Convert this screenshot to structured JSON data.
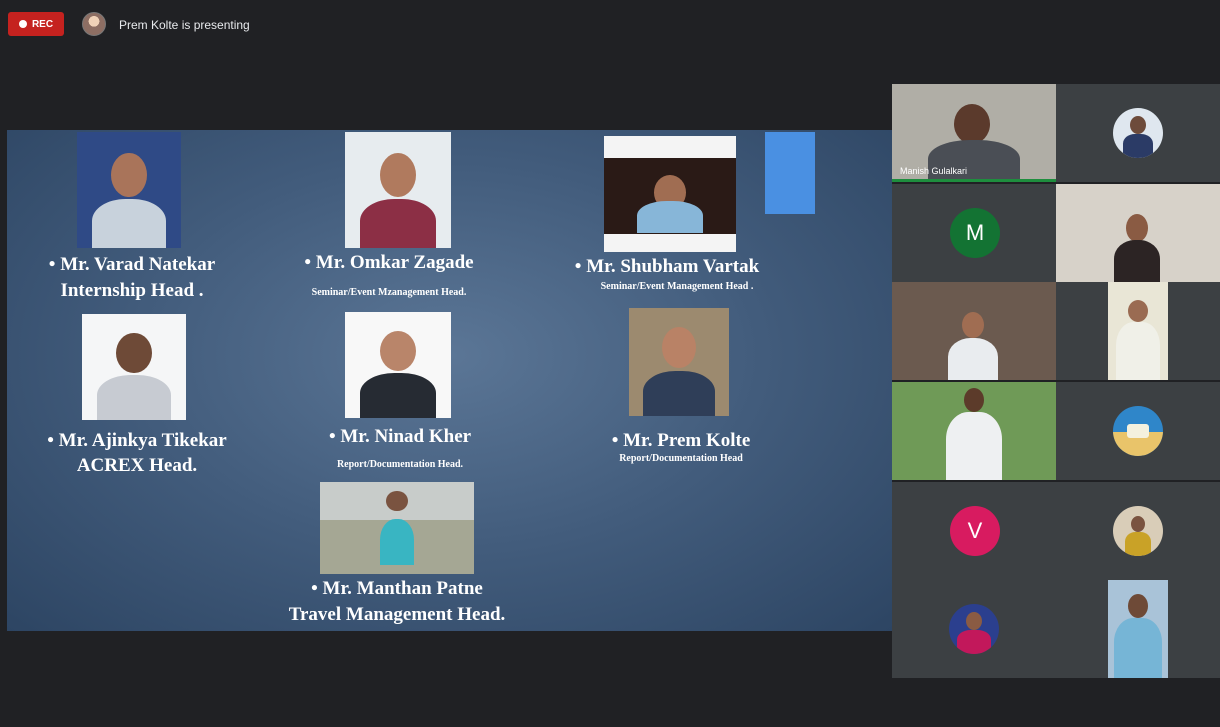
{
  "meeting": {
    "rec_label": "REC",
    "presenting_text": "Prem Kolte is presenting"
  },
  "slide": {
    "members": [
      {
        "name": "• Mr. Varad Natekar",
        "role": "Internship Head ."
      },
      {
        "name": "• Mr. Omkar Zagade",
        "role": "Seminar/Event Mzanagement Head."
      },
      {
        "name": "• Mr. Shubham Vartak",
        "role": "Seminar/Event Management Head ."
      },
      {
        "name": "• Mr. Ajinkya Tikekar",
        "role": "ACREX Head."
      },
      {
        "name": "• Mr. Ninad Kher",
        "role": "Report/Documentation Head."
      },
      {
        "name": "• Mr. Prem Kolte",
        "role": "Report/Documentation Head"
      },
      {
        "name": "• Mr. Manthan Patne",
        "role": "Travel Management Head."
      }
    ]
  },
  "participants": {
    "speaker_label": "Manish Gulalkari",
    "m_letter": "M",
    "v_letter": "V",
    "colors": {
      "m_avatar": "#137333",
      "v_avatar": "#d81b60",
      "speaking": "#1e8e3e",
      "rec": "#c5221f"
    }
  }
}
